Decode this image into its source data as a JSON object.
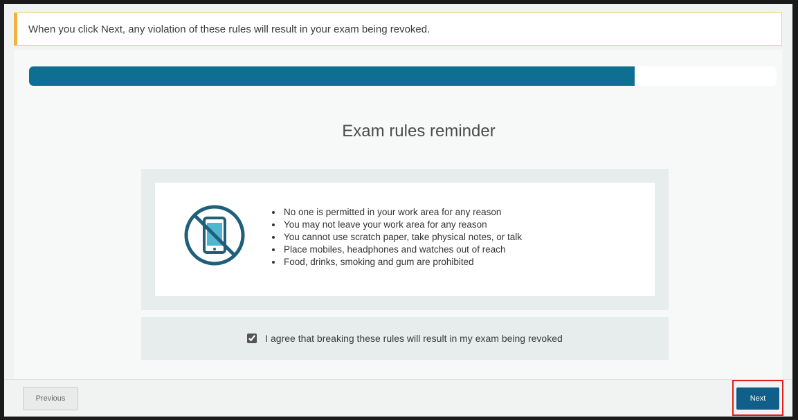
{
  "banner": {
    "text": "When you click Next, any violation of these rules will result in your exam being revoked.",
    "accent_color": "#f3b23a"
  },
  "progress": {
    "fraction": 0.81,
    "fill_color": "#0f6f93"
  },
  "page": {
    "title": "Exam rules reminder"
  },
  "rules": {
    "icon": "no-phone-icon",
    "items": [
      "No one is permitted in your work area for any reason",
      "You may not leave your work area for any reason",
      "You cannot use scratch paper, take physical notes, or talk",
      "Place mobiles, headphones and watches out of reach",
      "Food, drinks, smoking and gum are prohibited"
    ]
  },
  "agreement": {
    "checked": true,
    "label": "I agree that breaking these rules will result in my exam being revoked"
  },
  "footer": {
    "previous_label": "Previous",
    "next_label": "Next",
    "next_color": "#0f5f88",
    "highlight_color": "#e02020"
  }
}
